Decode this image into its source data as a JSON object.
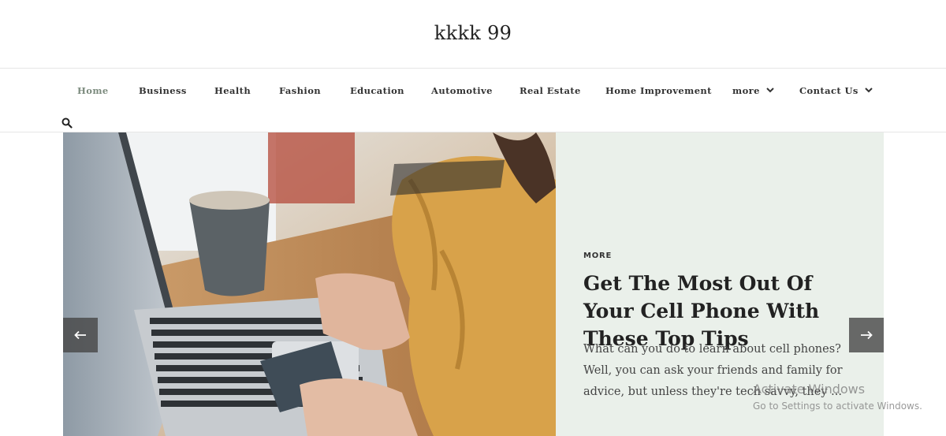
{
  "site": {
    "title": "kkkk 99"
  },
  "nav": {
    "items": [
      {
        "label": "Home",
        "active": true
      },
      {
        "label": "Business"
      },
      {
        "label": "Health"
      },
      {
        "label": "Fashion"
      },
      {
        "label": "Education"
      },
      {
        "label": "Automotive"
      },
      {
        "label": "Real Estate"
      },
      {
        "label": "Home Improvement"
      },
      {
        "label": "more",
        "has_dropdown": true
      },
      {
        "label": "Contact Us",
        "has_dropdown": true
      }
    ],
    "search_icon": "search-icon",
    "active_color": "#7c8b7e"
  },
  "slider": {
    "category": "MORE",
    "title": "Get The Most Out Of Your Cell Phone With These Top Tips",
    "excerpt": "What can you do to learn about cell phones? Well, you can ask your friends and family for advice, but unless they're tech savvy, they ...",
    "image_alt": "laptop-and-card-photo",
    "panel_color": "#eaf0ea",
    "prev_icon": "arrow-left-icon",
    "next_icon": "arrow-right-icon"
  },
  "watermark": {
    "title": "Activate Windows",
    "subtitle": "Go to Settings to activate Windows."
  }
}
